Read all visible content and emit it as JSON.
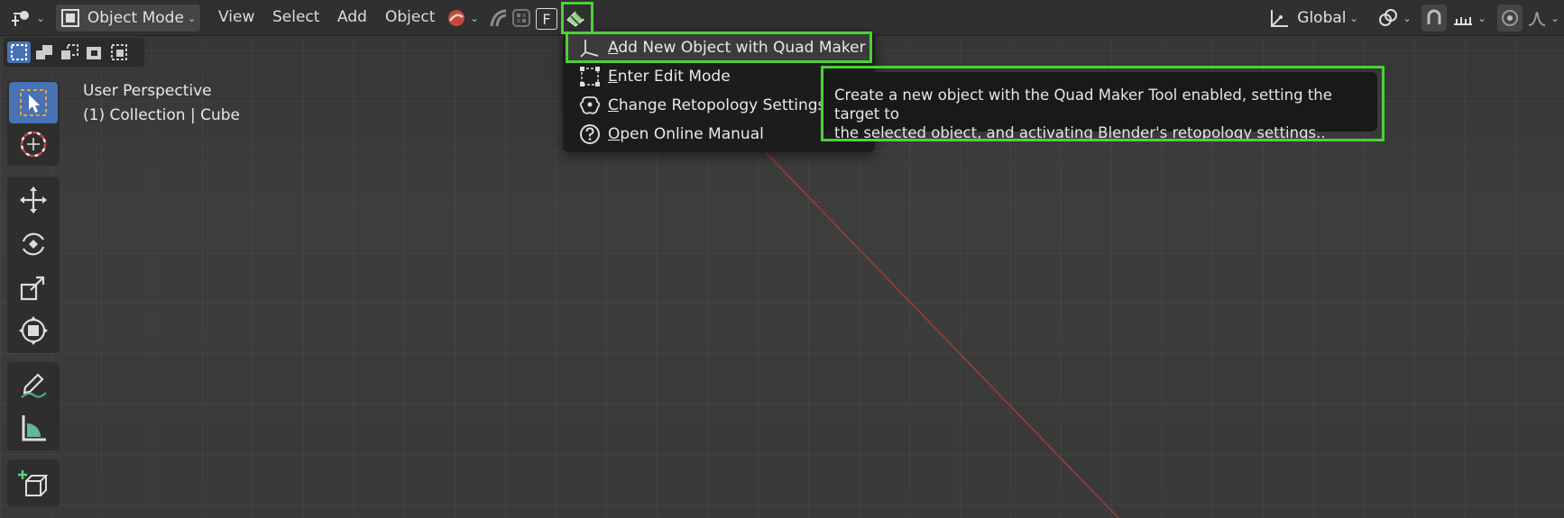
{
  "header": {
    "mode_label": "Object Mode",
    "menus": [
      "View",
      "Select",
      "Add",
      "Object"
    ],
    "f_button": "F",
    "orientation_label": "Global"
  },
  "viewport": {
    "perspective_label": "User Perspective",
    "collection_label": "(1) Collection | Cube"
  },
  "menu": {
    "items": [
      {
        "mnemonic": "A",
        "rest": "dd New Object with Quad Maker",
        "icon": "add-object-icon"
      },
      {
        "mnemonic": "E",
        "rest": "nter Edit Mode",
        "icon": "edit-mode-icon"
      },
      {
        "mnemonic": "C",
        "rest": "hange Retopology Settings",
        "icon": "settings-icon"
      },
      {
        "mnemonic": "O",
        "rest": "pen Online Manual",
        "icon": "help-icon"
      }
    ]
  },
  "tooltip": {
    "line1": "Create a new object with the Quad Maker Tool enabled, setting the target to",
    "line2": "the selected object, and activating Blender's retopology settings.."
  },
  "colors": {
    "highlight": "#4cd137",
    "accent": "#4772b3",
    "axis_red": "#b03a3a"
  }
}
